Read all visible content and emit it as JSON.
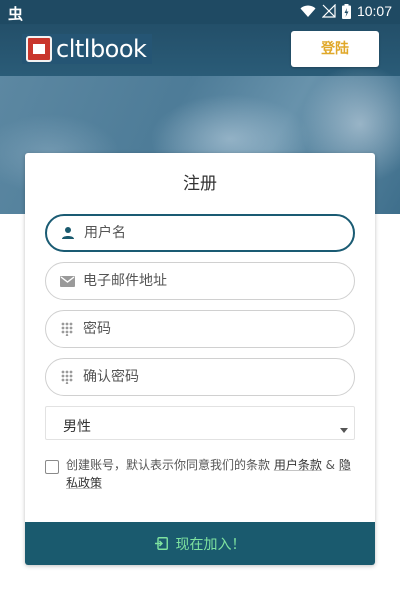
{
  "status_bar": {
    "left_glyph": "虫",
    "time": "10:07"
  },
  "header": {
    "logo_text": "cltlbook",
    "login_label": "登陆"
  },
  "form": {
    "title": "注册",
    "username": {
      "placeholder": "用户名",
      "value": "",
      "icon": "person-icon"
    },
    "email": {
      "placeholder": "电子邮件地址",
      "value": "",
      "icon": "mail-icon"
    },
    "password": {
      "placeholder": "密码",
      "value": "",
      "icon": "dots-grid-icon"
    },
    "confirm_password": {
      "placeholder": "确认密码",
      "value": "",
      "icon": "dots-grid-icon"
    },
    "gender": {
      "selected": "男性"
    },
    "agreement": {
      "text": "创建账号，默认表示你同意我们的条款 ",
      "terms_link": "用户条款",
      "amp": " & ",
      "privacy_link": "隐私政策",
      "checked": false
    },
    "submit_label": "现在加入！"
  },
  "colors": {
    "primary": "#1a5a6e",
    "status_bar": "#1f4a63",
    "login_text": "#e0a82a",
    "submit_text": "#7fe3a0"
  }
}
